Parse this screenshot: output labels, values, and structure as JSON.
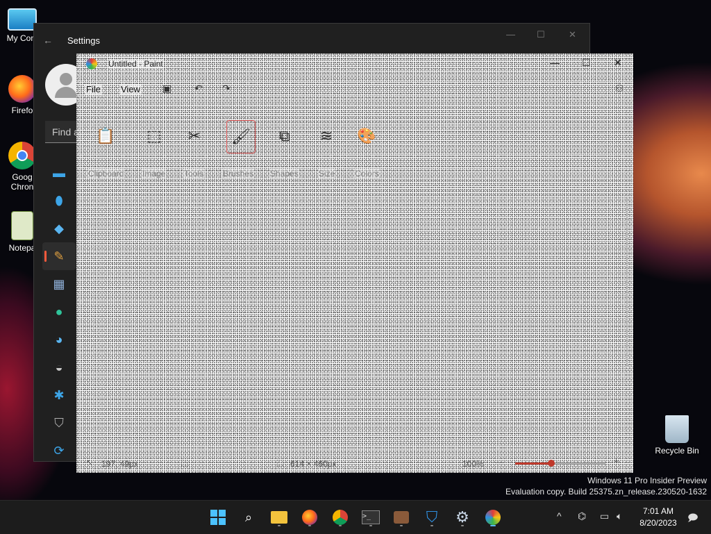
{
  "desktop": {
    "icons": [
      {
        "label": "My Com",
        "icon": "computer-icon"
      },
      {
        "label": "Firefo",
        "icon": "firefox-icon"
      },
      {
        "label": "Goog\nChron",
        "label1": "Goog",
        "label2": "Chron",
        "icon": "chrome-icon"
      },
      {
        "label": "Notepa",
        "icon": "notepad-icon"
      },
      {
        "label": "Recycle Bin",
        "icon": "recycle-bin-icon"
      }
    ],
    "watermark": {
      "line1": "Windows 11 Pro Insider Preview",
      "line2": "Evaluation copy. Build 25375.zn_release.230520-1632"
    }
  },
  "settings": {
    "title": "Settings",
    "search_placeholder": "Find a",
    "nav_icons": [
      "system-icon",
      "bluetooth-icon",
      "network-icon",
      "personalization-icon",
      "apps-icon",
      "accounts-icon",
      "time-language-icon",
      "gaming-icon",
      "accessibility-icon",
      "privacy-security-icon",
      "windows-update-icon"
    ]
  },
  "paint": {
    "title": "Untitled - Paint",
    "menu": {
      "file": "File",
      "view": "View"
    },
    "tool_groups": [
      "Clipboard",
      "Image",
      "Tools",
      "Brushes",
      "Shapes",
      "Size",
      "Colors"
    ],
    "selected_tool": "Brushes",
    "status": {
      "cursor_pos": "197, 49px",
      "canvas_size": "614 × 460px",
      "zoom": "100%"
    },
    "zoom_level": 0.4
  },
  "taskbar": {
    "apps": [
      "start-icon",
      "search-icon",
      "file-explorer-icon",
      "firefox-icon",
      "chrome-icon",
      "terminal-icon",
      "briefcase-icon",
      "defender-icon",
      "settings-icon",
      "paint-icon"
    ],
    "clock": {
      "time": "7:01 AM",
      "date": "8/20/2023"
    }
  },
  "colors": {
    "accent": "#c0392b",
    "settings_bg": "#202020",
    "taskbar_bg": "#1c1c1c"
  }
}
